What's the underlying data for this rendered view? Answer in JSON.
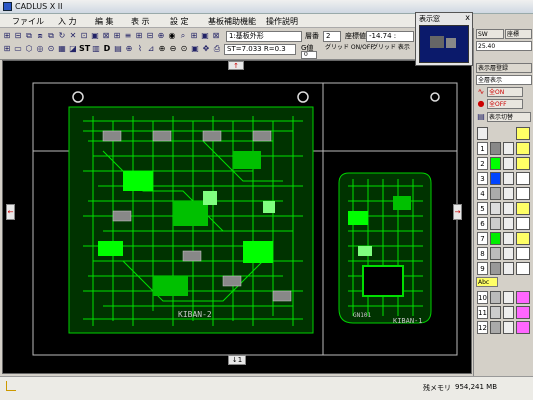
{
  "window": {
    "title": "CADLUS X II"
  },
  "menu": [
    "ファイル",
    "入 力",
    "編 集",
    "表 示",
    "設 定",
    "基板補助機能",
    "操作説明"
  ],
  "toolbar": {
    "layer_select": "1:基板外形",
    "layer_num_label": "層番",
    "layer_num_value": "2",
    "coord_label": "座標値",
    "coord_value": "-14.74 :",
    "st_text": "ST=7.033 R=0.3",
    "grid_label": "G値",
    "grid_value": "0",
    "grid_toggle": "グリッド ON/OFF",
    "grid_display": "グリッド 表示"
  },
  "preview": {
    "title": "表示窓",
    "close": "x"
  },
  "right_panel": {
    "sw_label": "SW",
    "coord_label": "座標",
    "value1": "25.40",
    "layer_title": "表示層登録",
    "all_display": "全層表示",
    "all_on": "全ON",
    "all_off": "全OFF",
    "switch_display": "表示切替",
    "abc_label": "Abc",
    "layers": [
      "1",
      "2",
      "3",
      "4",
      "5",
      "6",
      "7",
      "8",
      "9",
      "10",
      "11",
      "12"
    ]
  },
  "canvas": {
    "board_label_1": "KIBAN-2",
    "board_label_2": "KIBAN-1",
    "board_label_3": "GN101",
    "bottom_arrow": "↓1",
    "top_arrow": "↑",
    "left_arrow": "←",
    "right_arrow": "→"
  },
  "status": {
    "memory_label": "残メモリ",
    "memory_value": "954,241 MB"
  },
  "colors": {
    "canvas_bg": "#000000",
    "trace": "#00e000",
    "outline": "#c8c8c8",
    "accent": "#ff00ff"
  }
}
